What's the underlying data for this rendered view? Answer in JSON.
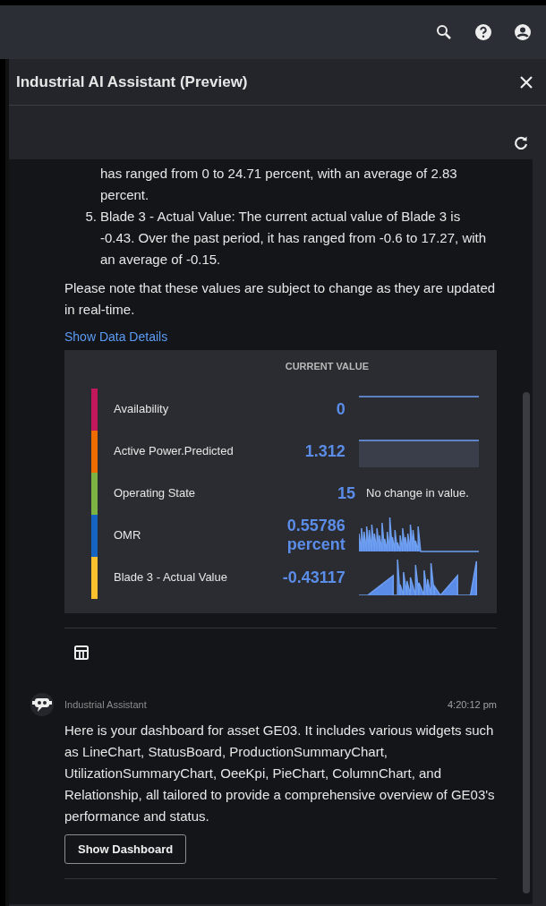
{
  "panel": {
    "title": "Industrial AI Assistant (Preview)"
  },
  "message": {
    "continuation": "has ranged from 0 to 24.71 percent, with an average of 2.83 percent.",
    "items": [
      {
        "number": "5.",
        "text": "Blade 3 - Actual Value: The current actual value of Blade 3 is -0.43. Over the past period, it has ranged from -0.6 to 17.27, with an average of -0.15."
      }
    ],
    "note": "Please note that these values are subject to change as they are updated in real-time.",
    "details_link": "Show Data Details",
    "data_table": {
      "header": "CURRENT VALUE",
      "rows": [
        {
          "name": "Availability",
          "color": "#c2185b",
          "value": "0",
          "kind": "flat"
        },
        {
          "name": "Active Power.Predicted",
          "color": "#ef6c00",
          "value": "1.312",
          "kind": "flat-filled"
        },
        {
          "name": "Operating State",
          "color": "#7cb342",
          "value": "15",
          "kind": "text",
          "note": "No change in value."
        },
        {
          "name": "OMR",
          "color": "#1565c0",
          "value": "0.55786 percent",
          "kind": "spiky"
        },
        {
          "name": "Blade 3 - Actual Value",
          "color": "#fbc02d",
          "value": "-0.43117",
          "kind": "ramp"
        }
      ]
    }
  },
  "reply": {
    "sender": "Industrial Assistant",
    "time": "4:20:12 pm",
    "text": "Here is your dashboard for asset GE03. It includes various widgets such as LineChart, StatusBoard, ProductionSummaryChart, UtilizationSummaryChart, OeeKpi, PieChart, ColumnChart, and Relationship, all tailored to provide a comprehensive overview of GE03's performance and status.",
    "button": "Show Dashboard"
  }
}
